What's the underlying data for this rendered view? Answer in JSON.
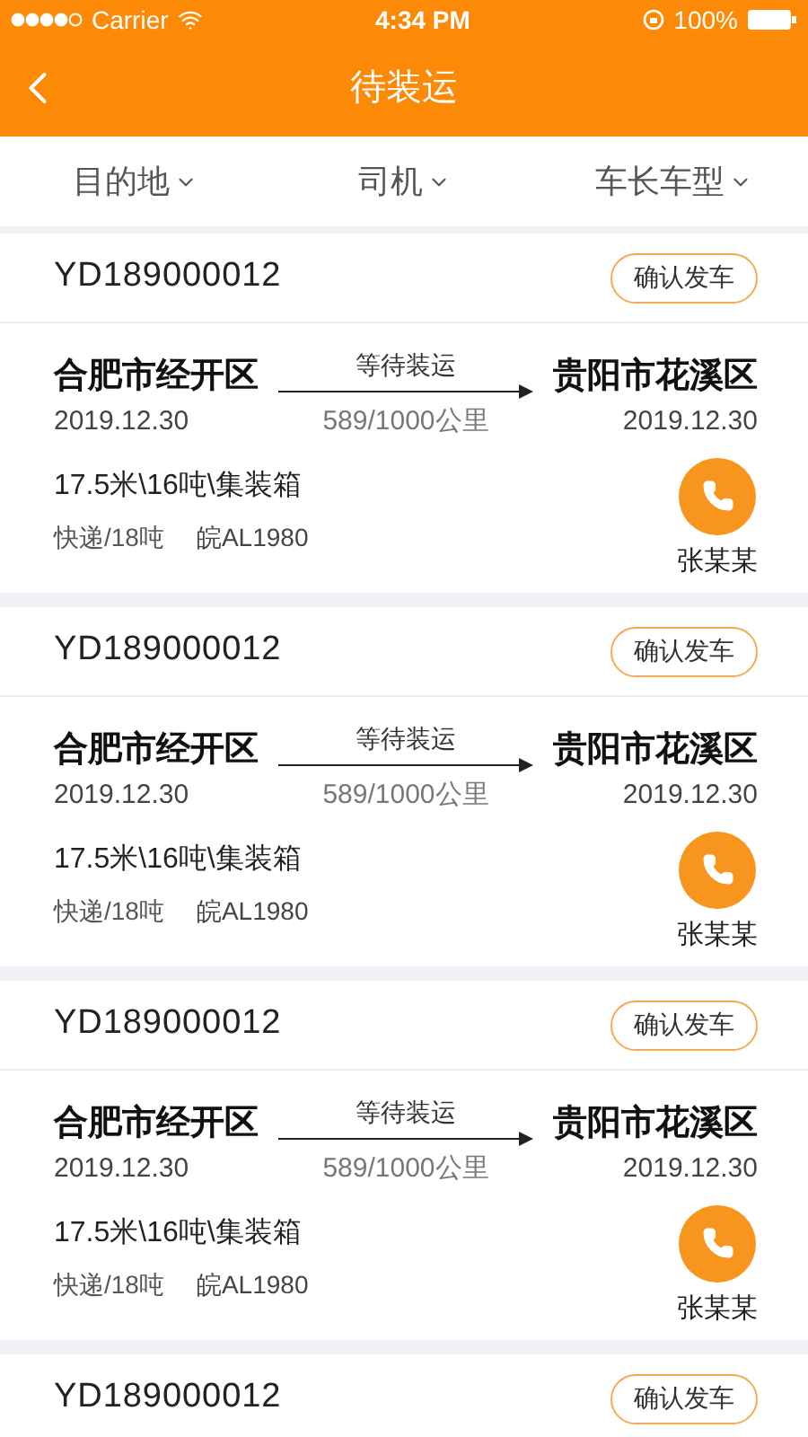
{
  "status_bar": {
    "carrier": "Carrier",
    "time": "4:34 PM",
    "battery": "100%"
  },
  "nav": {
    "title": "待装运"
  },
  "filters": [
    {
      "label": "目的地"
    },
    {
      "label": "司机"
    },
    {
      "label": "车长车型"
    }
  ],
  "orders": [
    {
      "number": "YD189000012",
      "action": "确认发车",
      "origin": "合肥市经开区",
      "origin_date": "2019.12.30",
      "status": "等待装运",
      "distance": "589/1000公里",
      "destination": "贵阳市花溪区",
      "destination_date": "2019.12.30",
      "vehicle": "17.5米\\16吨\\集装箱",
      "cargo": "快递/18吨",
      "plate": "皖AL1980",
      "driver": "张某某"
    },
    {
      "number": "YD189000012",
      "action": "确认发车",
      "origin": "合肥市经开区",
      "origin_date": "2019.12.30",
      "status": "等待装运",
      "distance": "589/1000公里",
      "destination": "贵阳市花溪区",
      "destination_date": "2019.12.30",
      "vehicle": "17.5米\\16吨\\集装箱",
      "cargo": "快递/18吨",
      "plate": "皖AL1980",
      "driver": "张某某"
    },
    {
      "number": "YD189000012",
      "action": "确认发车",
      "origin": "合肥市经开区",
      "origin_date": "2019.12.30",
      "status": "等待装运",
      "distance": "589/1000公里",
      "destination": "贵阳市花溪区",
      "destination_date": "2019.12.30",
      "vehicle": "17.5米\\16吨\\集装箱",
      "cargo": "快递/18吨",
      "plate": "皖AL1980",
      "driver": "张某某"
    },
    {
      "number": "YD189000012",
      "action": "确认发车"
    }
  ]
}
